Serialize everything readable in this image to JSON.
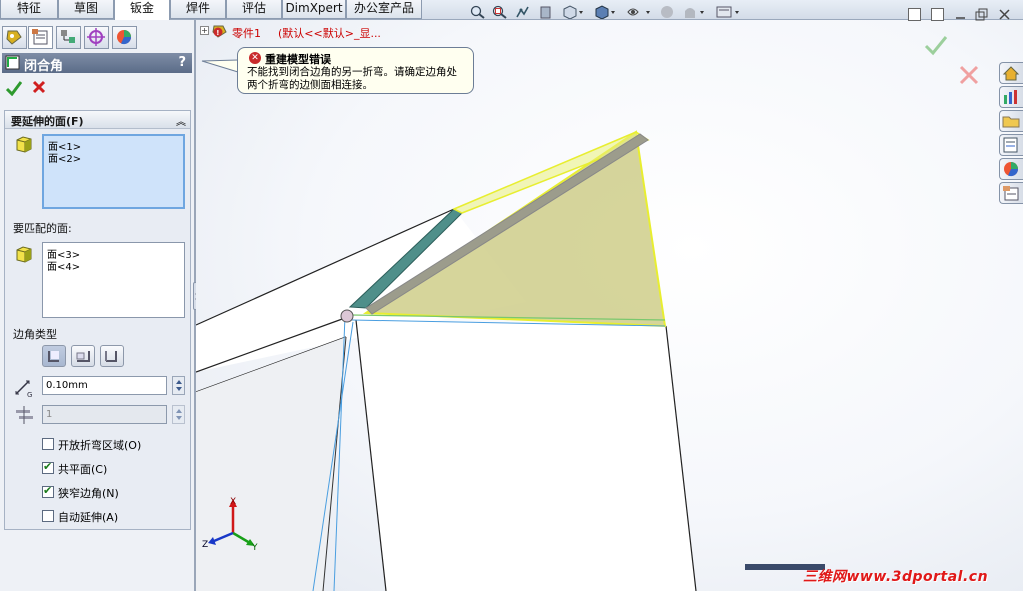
{
  "tabs": [
    {
      "label": "特征",
      "active": false
    },
    {
      "label": "草图",
      "active": false
    },
    {
      "label": "钣金",
      "active": true
    },
    {
      "label": "焊件",
      "active": false
    },
    {
      "label": "评估",
      "active": false
    },
    {
      "label": "DimXpert",
      "active": false
    },
    {
      "label": "办公室产品",
      "active": false
    }
  ],
  "toolbar": {
    "icons": [
      "zoom-to-fit-icon",
      "zoom-area-icon",
      "previous-view-icon",
      "section-view-icon",
      "view-orientation-icon",
      "display-style-icon",
      "hide-show-icon",
      "edit-appearance-icon",
      "apply-scene-icon",
      "view-settings-icon"
    ]
  },
  "property_manager": {
    "title": "闭合角",
    "help": "?",
    "ok_icon": "check-icon",
    "cancel_icon": "x-icon",
    "group_title": "要延伸的面(F)",
    "extend_faces": [
      "面<1>",
      "面<2>"
    ],
    "match_faces_label": "要匹配的面:",
    "match_faces": [
      "面<3>",
      "面<4>"
    ],
    "corner_type_label": "边角类型",
    "gap_value": "0.10mm",
    "overlap_value": "1",
    "checkboxes": [
      {
        "label": "开放折弯区域(O)",
        "checked": false
      },
      {
        "label": "共平面(C)",
        "checked": true
      },
      {
        "label": "狭窄边角(N)",
        "checked": true
      },
      {
        "label": "自动延伸(A)",
        "checked": false
      }
    ]
  },
  "tree": {
    "plus": "+",
    "part_name": "零件1",
    "config": "(默认<<默认>_显..."
  },
  "error_tooltip": {
    "title": "重建模型错误",
    "body": "不能找到闭合边角的另一折弯。请确定边角处两个折弯的边侧面相连接。"
  },
  "triad": {
    "x": "X",
    "y": "Y",
    "z": "Z"
  },
  "watermark": "三维网www.3dportal.cn",
  "colors": {
    "accent_green": "#2e9a2e",
    "cancel_red": "#d02020",
    "error_text": "#c00000",
    "selection_yellow": "#e8ee30",
    "teal_face": "#4f8f8a"
  }
}
